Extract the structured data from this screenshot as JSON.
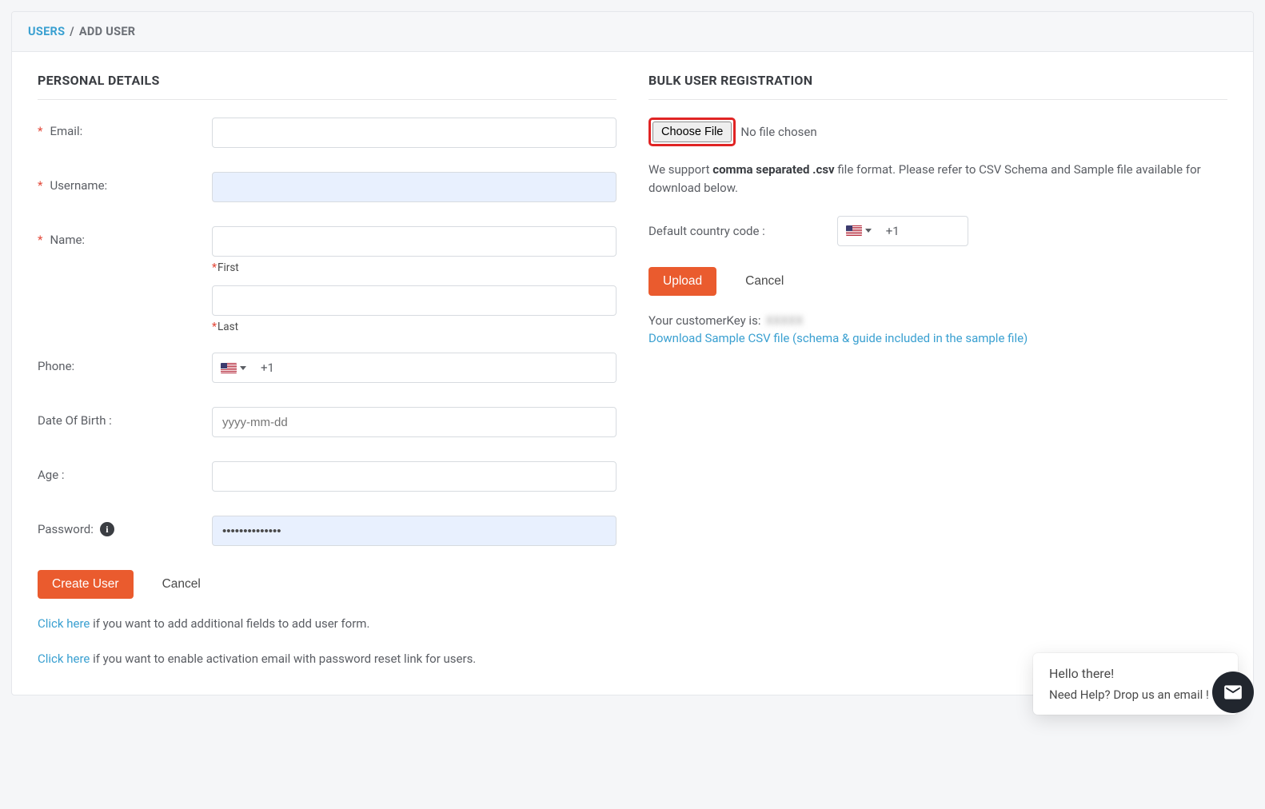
{
  "breadcrumb": {
    "users": "USERS",
    "sep": "/",
    "current": "ADD USER"
  },
  "left": {
    "section_title": "PERSONAL DETAILS",
    "email_label": "Email:",
    "username_label": "Username:",
    "username_value": "",
    "name_label": "Name:",
    "first_sub": "First",
    "last_sub": "Last",
    "phone_label": "Phone:",
    "dial_code": "+1",
    "dob_label": "Date Of Birth :",
    "dob_placeholder": "yyyy-mm-dd",
    "age_label": "Age :",
    "password_label": "Password:",
    "password_value": "••••••••••••••",
    "create_btn": "Create User",
    "cancel_btn": "Cancel",
    "help1_link": "Click here",
    "help1_text": " if you want to add additional fields to add user form.",
    "help2_link": "Click here",
    "help2_text": " if you want to enable activation email with password reset link for users."
  },
  "right": {
    "section_title": "BULK USER REGISTRATION",
    "choose_file": "Choose File",
    "no_file": "No file chosen",
    "desc_pre": "We support ",
    "desc_bold": "comma separated .csv",
    "desc_post": " file format. Please refer to CSV Schema and Sample file available for download below.",
    "dc_label": "Default country code :",
    "dc_value": "+1",
    "upload_btn": "Upload",
    "cancel_btn": "Cancel",
    "key_label": "Your customerKey is: ",
    "key_value": "XXXXX",
    "sample_link": "Download Sample CSV file (schema & guide included in the sample file)"
  },
  "chat": {
    "greeting": "Hello there!",
    "prompt": "Need Help? Drop us an email !"
  }
}
